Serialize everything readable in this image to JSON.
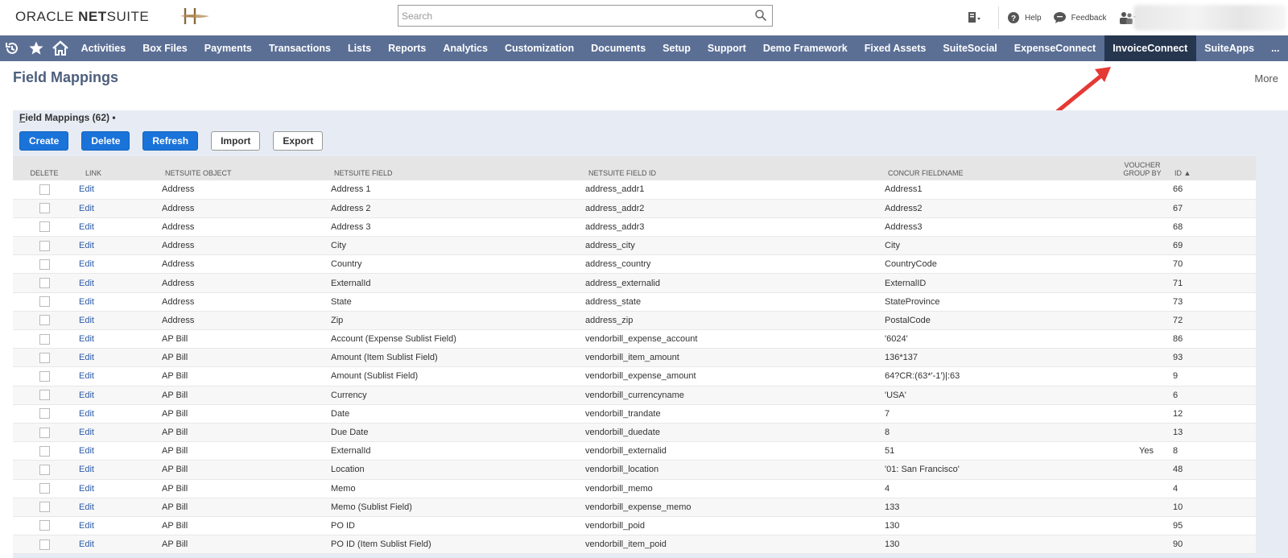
{
  "header": {
    "logo_part1": "ORACLE",
    "logo_part2": "NET",
    "logo_part3": "SUITE",
    "search_placeholder": "Search",
    "help_label": "Help",
    "feedback_label": "Feedback"
  },
  "nav": {
    "items": [
      {
        "label": "Activities"
      },
      {
        "label": "Box Files"
      },
      {
        "label": "Payments"
      },
      {
        "label": "Transactions"
      },
      {
        "label": "Lists"
      },
      {
        "label": "Reports"
      },
      {
        "label": "Analytics"
      },
      {
        "label": "Customization"
      },
      {
        "label": "Documents"
      },
      {
        "label": "Setup"
      },
      {
        "label": "Support"
      },
      {
        "label": "Demo Framework"
      },
      {
        "label": "Fixed Assets"
      },
      {
        "label": "SuiteSocial"
      },
      {
        "label": "ExpenseConnect"
      },
      {
        "label": "InvoiceConnect"
      },
      {
        "label": "SuiteApps"
      },
      {
        "label": "..."
      }
    ],
    "active_index": 15
  },
  "page": {
    "title": "Field Mappings",
    "more_label": "More",
    "list_tab": "Field Mappings (62)",
    "list_tab_first": "F",
    "list_tab_rest": "ield Mappings (62)",
    "list_tab_suffix": " •"
  },
  "toolbar": {
    "create_label": "Create",
    "delete_label": "Delete",
    "refresh_label": "Refresh",
    "import_label": "Import",
    "export_label": "Export"
  },
  "table": {
    "headers": {
      "delete": "DELETE",
      "link": "LINK",
      "object": "NETSUITE OBJECT",
      "field": "NETSUITE FIELD",
      "field_id": "NETSUITE FIELD ID",
      "concur": "CONCUR FIELDNAME",
      "voucher1": "VOUCHER",
      "voucher2": "GROUP BY",
      "id": "ID ▲"
    },
    "rows": [
      {
        "link": "Edit",
        "object": "Address",
        "field": "Address 1",
        "field_id": "address_addr1",
        "concur": "Address1",
        "voucher": "",
        "id": "66"
      },
      {
        "link": "Edit",
        "object": "Address",
        "field": "Address 2",
        "field_id": "address_addr2",
        "concur": "Address2",
        "voucher": "",
        "id": "67"
      },
      {
        "link": "Edit",
        "object": "Address",
        "field": "Address 3",
        "field_id": "address_addr3",
        "concur": "Address3",
        "voucher": "",
        "id": "68"
      },
      {
        "link": "Edit",
        "object": "Address",
        "field": "City",
        "field_id": "address_city",
        "concur": "City",
        "voucher": "",
        "id": "69"
      },
      {
        "link": "Edit",
        "object": "Address",
        "field": "Country",
        "field_id": "address_country",
        "concur": "CountryCode",
        "voucher": "",
        "id": "70"
      },
      {
        "link": "Edit",
        "object": "Address",
        "field": "ExternalId",
        "field_id": "address_externalid",
        "concur": "ExternalID",
        "voucher": "",
        "id": "71"
      },
      {
        "link": "Edit",
        "object": "Address",
        "field": "State",
        "field_id": "address_state",
        "concur": "StateProvince",
        "voucher": "",
        "id": "73"
      },
      {
        "link": "Edit",
        "object": "Address",
        "field": "Zip",
        "field_id": "address_zip",
        "concur": "PostalCode",
        "voucher": "",
        "id": "72"
      },
      {
        "link": "Edit",
        "object": "AP Bill",
        "field": "Account (Expense Sublist Field)",
        "field_id": "vendorbill_expense_account",
        "concur": "'6024'",
        "voucher": "",
        "id": "86"
      },
      {
        "link": "Edit",
        "object": "AP Bill",
        "field": "Amount (Item Sublist Field)",
        "field_id": "vendorbill_item_amount",
        "concur": "136*137",
        "voucher": "",
        "id": "93"
      },
      {
        "link": "Edit",
        "object": "AP Bill",
        "field": "Amount (Sublist Field)",
        "field_id": "vendorbill_expense_amount",
        "concur": "64?CR:(63*'-1')|:63",
        "voucher": "",
        "id": "9"
      },
      {
        "link": "Edit",
        "object": "AP Bill",
        "field": "Currency",
        "field_id": "vendorbill_currencyname",
        "concur": "'USA'",
        "voucher": "",
        "id": "6"
      },
      {
        "link": "Edit",
        "object": "AP Bill",
        "field": "Date",
        "field_id": "vendorbill_trandate",
        "concur": "7",
        "voucher": "",
        "id": "12"
      },
      {
        "link": "Edit",
        "object": "AP Bill",
        "field": "Due Date",
        "field_id": "vendorbill_duedate",
        "concur": "8",
        "voucher": "",
        "id": "13"
      },
      {
        "link": "Edit",
        "object": "AP Bill",
        "field": "ExternalId",
        "field_id": "vendorbill_externalid",
        "concur": "51",
        "voucher": "Yes",
        "id": "8"
      },
      {
        "link": "Edit",
        "object": "AP Bill",
        "field": "Location",
        "field_id": "vendorbill_location",
        "concur": "'01: San Francisco'",
        "voucher": "",
        "id": "48"
      },
      {
        "link": "Edit",
        "object": "AP Bill",
        "field": "Memo",
        "field_id": "vendorbill_memo",
        "concur": "4",
        "voucher": "",
        "id": "4"
      },
      {
        "link": "Edit",
        "object": "AP Bill",
        "field": "Memo (Sublist Field)",
        "field_id": "vendorbill_expense_memo",
        "concur": "133",
        "voucher": "",
        "id": "10"
      },
      {
        "link": "Edit",
        "object": "AP Bill",
        "field": "PO ID",
        "field_id": "vendorbill_poid",
        "concur": "130",
        "voucher": "",
        "id": "95"
      },
      {
        "link": "Edit",
        "object": "AP Bill",
        "field": "PO ID (Item Sublist Field)",
        "field_id": "vendorbill_item_poid",
        "concur": "130",
        "voucher": "",
        "id": "90"
      }
    ]
  }
}
